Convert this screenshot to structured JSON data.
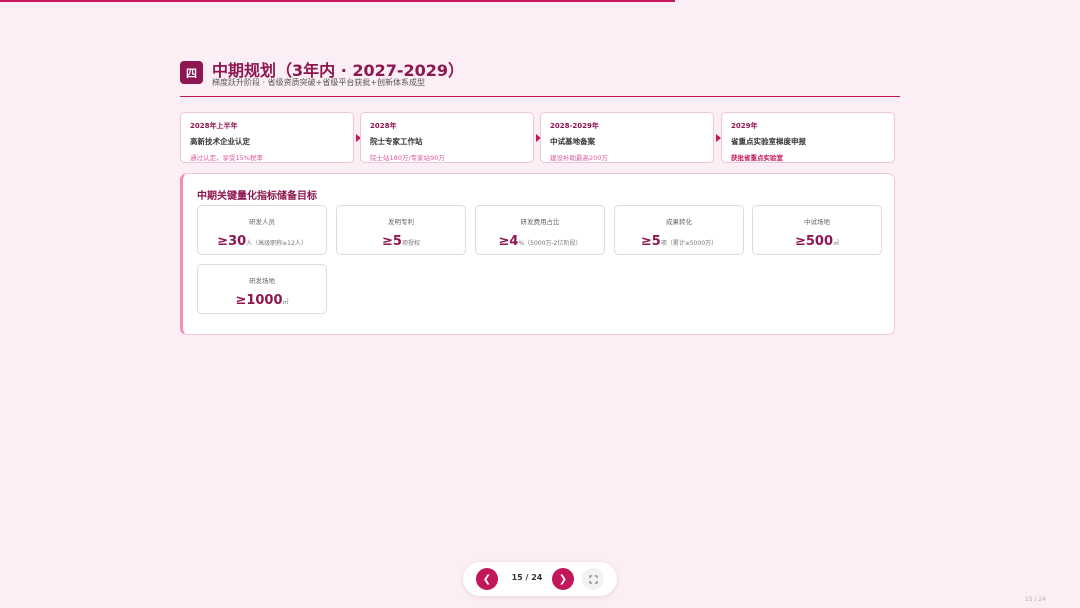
{
  "progress": {
    "fraction": 0.625
  },
  "header": {
    "badge": "四",
    "title": "中期规划（3年内 · 2027-2029）",
    "subtitle": "梯度跃升阶段 · 省级资质突破+省级平台获批+创新体系成型"
  },
  "timeline": [
    {
      "year": "2028年上半年",
      "name": "高新技术企业认定",
      "note": "通过认定，享受15%税率",
      "emphasis": false
    },
    {
      "year": "2028年",
      "name": "院士专家工作站",
      "note": "院士站180万/专家站90万",
      "emphasis": false
    },
    {
      "year": "2028-2029年",
      "name": "中试基地备案",
      "note": "建设补助最高200万",
      "emphasis": false
    },
    {
      "year": "2029年",
      "name": "省重点实验室梯度申报",
      "note": "获批省重点实验室",
      "emphasis": true
    }
  ],
  "panel": {
    "title": "中期关键量化指标储备目标",
    "metrics": [
      {
        "label": "研发人员",
        "value": "≥30",
        "unit": "人（高级职称≥12人）"
      },
      {
        "label": "发明专利",
        "value": "≥5",
        "unit": "项授权"
      },
      {
        "label": "研发费用占比",
        "value": "≥4",
        "unit": "%（5000万-2亿阶段）"
      },
      {
        "label": "成果转化",
        "value": "≥5",
        "unit": "项（累计≥5000万）"
      },
      {
        "label": "中试场地",
        "value": "≥500",
        "unit": "㎡"
      },
      {
        "label": "研发场地",
        "value": "≥1000",
        "unit": "㎡"
      }
    ]
  },
  "nav": {
    "prev_label": "❮",
    "next_label": "❯",
    "page_indicator": "15 / 24",
    "fullscreen_icon": "fullscreen-icon"
  },
  "footer": {
    "page_number": "15 / 24"
  },
  "colors": {
    "accent": "#c2185b",
    "brand_dark": "#8e1651",
    "background": "#fbeff5"
  }
}
